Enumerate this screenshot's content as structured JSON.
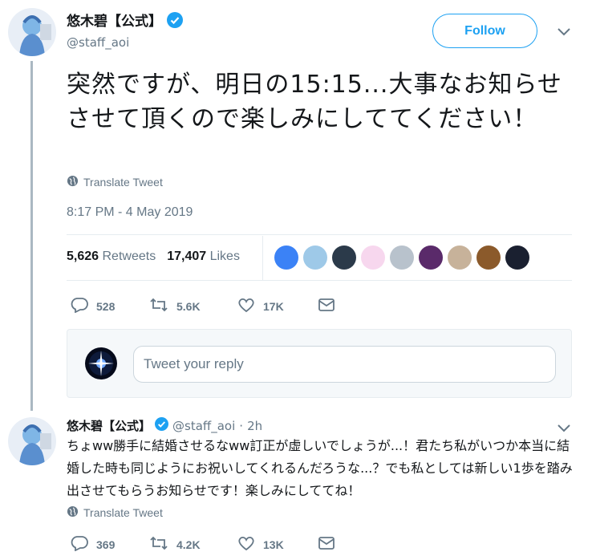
{
  "main_tweet": {
    "display_name": "悠木碧【公式】",
    "handle": "@staff_aoi",
    "follow_label": "Follow",
    "text": "突然ですが、明日の15:15...大事なお知らせさせて頂くので楽しみにしててください！",
    "translate_label": "Translate Tweet",
    "timestamp": "8:17 PM - 4 May 2019",
    "retweets_count": "5,626",
    "retweets_label": "Retweets",
    "likes_count": "17,407",
    "likes_label": "Likes",
    "actions": {
      "replies": "528",
      "retweets": "5.6K",
      "likes": "17K"
    },
    "likers_colors": [
      "#3b82f6",
      "#9ec9e8",
      "#2b3a4a",
      "#f7d7ee",
      "#b8c2cc",
      "#5a2a6a",
      "#c7b29a",
      "#8b5a2b",
      "#1a2030"
    ]
  },
  "reply_box": {
    "placeholder": "Tweet your reply"
  },
  "reply_tweet": {
    "display_name": "悠木碧【公式】",
    "handle": "@staff_aoi",
    "separator": "·",
    "time_ago": "2h",
    "text": "ちょww勝手に結婚させるなww訂正が虚しいでしょうが...！君たち私がいつか本当に結婚した時も同じようにお祝いしてくれるんだろうな...？でも私としては新しい1歩を踏み出させてもらうお知らせです！楽しみにしててね！",
    "translate_label": "Translate Tweet",
    "actions": {
      "replies": "369",
      "retweets": "4.2K",
      "likes": "13K"
    }
  },
  "colors": {
    "accent": "#1da1f2",
    "muted": "#657786",
    "text": "#14171a",
    "divider": "#e6ecf0"
  }
}
